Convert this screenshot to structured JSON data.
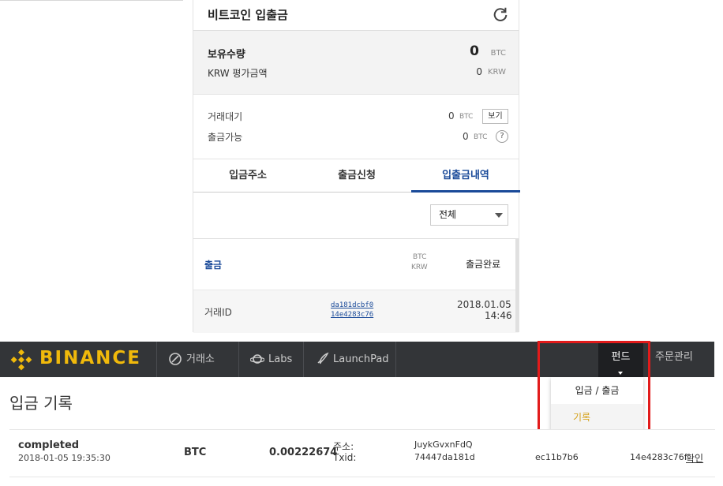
{
  "bithumb": {
    "title": "비트코인 입출금",
    "holdings": {
      "label": "보유수량",
      "value": "0",
      "unit": "BTC"
    },
    "krw": {
      "label": "KRW 평가금액",
      "value": "0",
      "unit": "KRW"
    },
    "pending": {
      "label": "거래대기",
      "value": "0",
      "unit": "BTC",
      "button": "보기"
    },
    "available": {
      "label": "출금가능",
      "value": "0",
      "unit": "BTC",
      "help": "?"
    },
    "tabs": [
      "입금주소",
      "출금신청",
      "입출금내역"
    ],
    "filter": "전체",
    "history": {
      "type": "출금",
      "currency_top": "BTC",
      "currency_bottom": "KRW",
      "status": "출금완료",
      "txid_label": "거래ID",
      "txid_line1": "da181dcbf0",
      "txid_line2": "14e4283c76",
      "date": "2018.01.05",
      "time": "14:46"
    }
  },
  "binance": {
    "brand": "BINANCE",
    "nav": [
      "거래소",
      "Labs",
      "LaunchPad"
    ],
    "fund": "펀드",
    "orders": "주문관리",
    "dropdown": [
      "입금 / 출금",
      "기록"
    ],
    "colors": {
      "brand": "#f0b90b",
      "navbar": "#333538",
      "highlight": "#e21b1b"
    }
  },
  "deposit": {
    "title": "입금 기록",
    "row": {
      "status": "completed",
      "datetime": "2018-01-05 19:35:30",
      "coin": "BTC",
      "amount": "0.00222674",
      "address_label": "주소:",
      "txid_label": "Txid:",
      "address": "JuykGvxnFdQ",
      "txid_part1": "74447da181dc",
      "txid_part2": "ec11b7b6",
      "txid_part3": "14e4283c76f",
      "confirm": "확인"
    }
  }
}
